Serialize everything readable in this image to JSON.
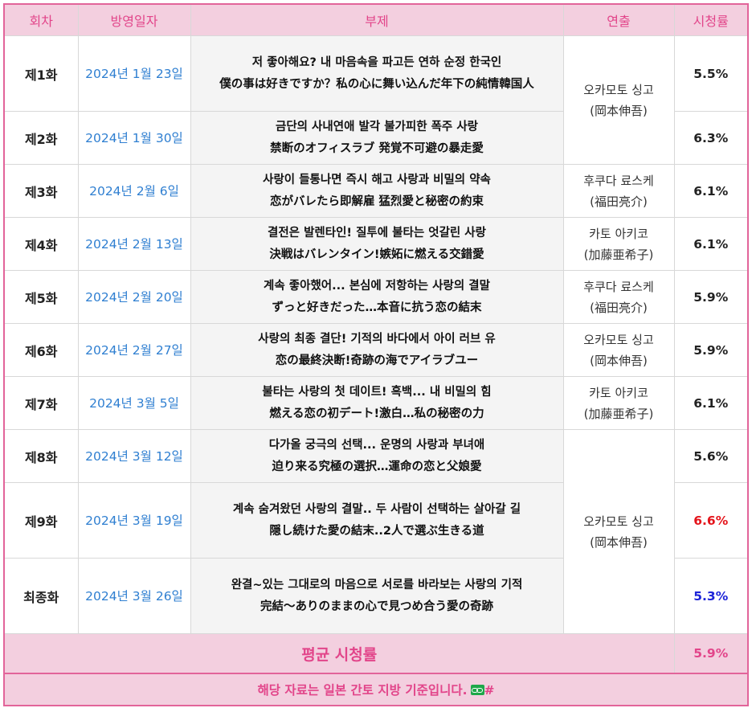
{
  "headers": {
    "episode": "회차",
    "air_date": "방영일자",
    "subtitle": "부제",
    "director": "연출",
    "rating": "시청률"
  },
  "episodes": [
    {
      "episode": "제1화",
      "date": "2024년 1월 23일",
      "title_ko": "저 좋아해요? 내 마음속을 파고든 연하 순정 한국인",
      "title_ja": "僕の事は好きですか？私の心に舞い込んだ年下の純情韓国人",
      "rating": "5.5%"
    },
    {
      "episode": "제2화",
      "date": "2024년 1월 30일",
      "title_ko": "금단의 사내연애 발각 불가피한 폭주 사랑",
      "title_ja": "禁断のオフィスラブ 発覚不可避の暴走愛",
      "rating": "6.3%"
    },
    {
      "episode": "제3화",
      "date": "2024년 2월 6일",
      "title_ko": "사랑이 들통나면 즉시 해고 사랑과 비밀의 약속",
      "title_ja": "恋がバレたら即解雇 猛烈愛と秘密の約束",
      "rating": "6.1%"
    },
    {
      "episode": "제4화",
      "date": "2024년 2월 13일",
      "title_ko": "결전은 발렌타인! 질투에 불타는 엇갈린 사랑",
      "title_ja": "決戦はバレンタイン!嫉妬に燃える交錯愛",
      "rating": "6.1%"
    },
    {
      "episode": "제5화",
      "date": "2024년 2월 20일",
      "title_ko": "계속 좋아했어... 본심에 저항하는 사랑의 결말",
      "title_ja": "ずっと好きだった…本音に抗う恋の結末",
      "rating": "5.9%"
    },
    {
      "episode": "제6화",
      "date": "2024년 2월 27일",
      "title_ko": "사랑의 최종 결단! 기적의 바다에서 아이 러브 유",
      "title_ja": "恋の最終決断!奇跡の海でアイラブユー",
      "rating": "5.9%"
    },
    {
      "episode": "제7화",
      "date": "2024년 3월 5일",
      "title_ko": "불타는 사랑의 첫 데이트! 흑백... 내 비밀의 힘",
      "title_ja": "燃える恋の初デート!激白…私の秘密の力",
      "rating": "6.1%"
    },
    {
      "episode": "제8화",
      "date": "2024년 3월 12일",
      "title_ko": "다가올 궁극의 선택... 운명의 사랑과 부녀애",
      "title_ja": "迫り来る究極の選択…運命の恋と父娘愛",
      "rating": "5.6%"
    },
    {
      "episode": "제9화",
      "date": "2024년 3월 19일",
      "title_ko": "계속 숨겨왔던 사랑의 결말.. 두 사람이 선택하는 살아갈 길",
      "title_ja": "隠し続けた愛の結末..2人で選ぶ生きる道",
      "rating": "6.6%"
    },
    {
      "episode": "최종화",
      "date": "2024년 3월 26일",
      "title_ko": "완결~있는 그대로의 마음으로 서로를 바라보는 사랑의 기적",
      "title_ja": "完結～ありのままの心で見つめ合う愛の奇跡",
      "rating": "5.3%"
    }
  ],
  "directors": [
    {
      "name": "오카모토 싱고",
      "name_ja": "(岡本伸吾)"
    },
    {
      "name": "후쿠다 료스케",
      "name_ja": "(福田亮介)"
    },
    {
      "name": "카토 아키코",
      "name_ja": "(加藤亜希子)"
    },
    {
      "name": "후쿠다 료스케",
      "name_ja": "(福田亮介)"
    },
    {
      "name": "오카모토 싱고",
      "name_ja": "(岡本伸吾)"
    },
    {
      "name": "카토 아키코",
      "name_ja": "(加藤亜希子)"
    },
    {
      "name": "오카모토 싱고",
      "name_ja": "(岡本伸吾)"
    }
  ],
  "average": {
    "label": "평균 시청률",
    "value": "5.9%"
  },
  "note": {
    "text": "해당 자료는 일본 간토 지방 기준입니다.",
    "hash": "#"
  },
  "colors": {
    "header_bg": "#f3cfdf",
    "accent_pink": "#e2458a",
    "border_pink": "#e2649a",
    "date_blue": "#2f7fd1",
    "max_rating_red": "#e4141b",
    "min_rating_blue": "#1d24d8",
    "link_icon_green": "#1ea84a"
  },
  "icons": {
    "note_link": "link-icon"
  }
}
